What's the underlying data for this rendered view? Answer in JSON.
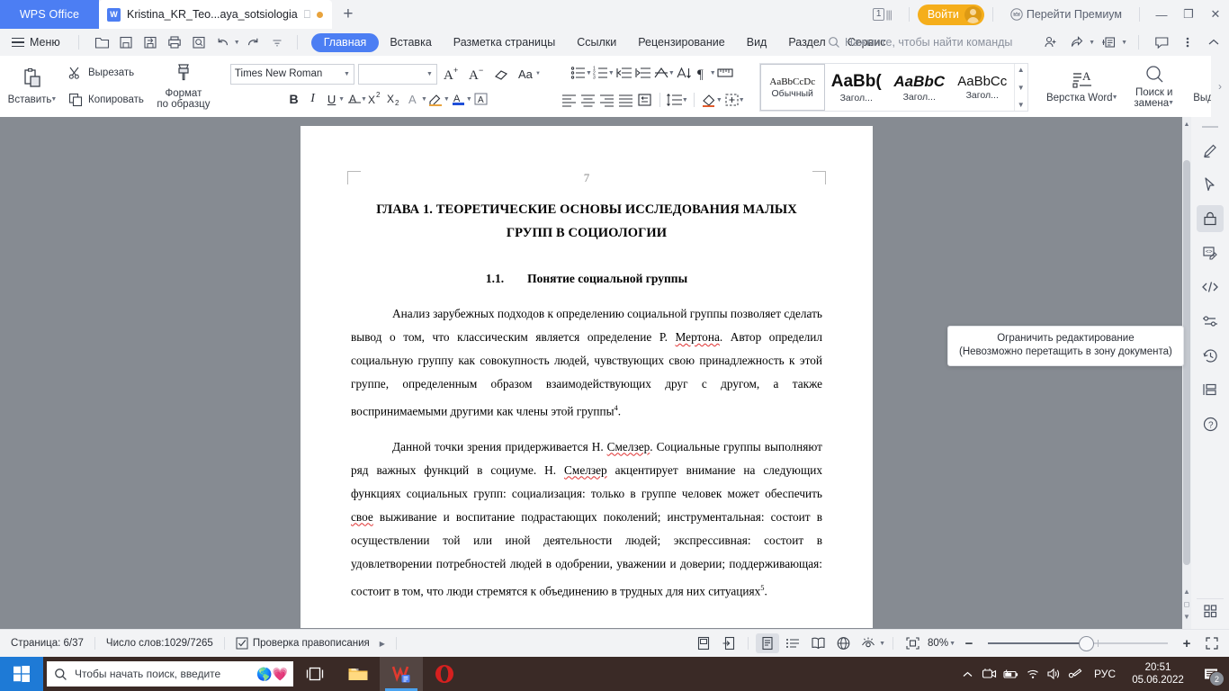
{
  "titlebar": {
    "app_name": "WPS Office",
    "tab_title": "Kristina_KR_Teo...aya_sotsiologia",
    "new_tab": "+",
    "count_badge": "1",
    "login_label": "Войти",
    "premium_label": "Перейти Премиум",
    "minimize": "—",
    "restore": "❐",
    "close": "✕"
  },
  "menurow": {
    "menu_label": "Меню",
    "quick_access": [
      "open-icon",
      "save-icon",
      "save-as-icon",
      "print-icon",
      "print-preview-icon",
      "undo-icon",
      "redo-icon",
      "customize-icon"
    ],
    "tabs": [
      {
        "label": "Главная",
        "active": true
      },
      {
        "label": "Вставка",
        "active": false
      },
      {
        "label": "Разметка страницы",
        "active": false
      },
      {
        "label": "Ссылки",
        "active": false
      },
      {
        "label": "Рецензирование",
        "active": false
      },
      {
        "label": "Вид",
        "active": false
      },
      {
        "label": "Раздел",
        "active": false
      },
      {
        "label": "Сервис",
        "active": false
      }
    ],
    "search_placeholder": "Нажмите, чтобы найти команды",
    "right_icons": [
      "add-user-icon",
      "share-icon",
      "collaborate-icon",
      "comment-icon",
      "more-icon",
      "collapse-ribbon-icon"
    ]
  },
  "ribbon": {
    "paste_label": "Вставить",
    "cut_label": "Вырезать",
    "copy_label": "Копировать",
    "format_painter_label": "Формат",
    "format_painter_label2": "по образцу",
    "font_name": "Times New Roman",
    "font_size": "",
    "font_buttons": [
      "grow-font-icon",
      "shrink-font-icon",
      "clear-format-icon",
      "change-case-icon"
    ],
    "format_buttons": [
      "bold-icon",
      "italic-icon",
      "underline-icon",
      "strikethrough-icon",
      "superscript-icon",
      "subscript-icon",
      "text-effects-icon",
      "highlight-icon",
      "font-color-icon",
      "character-border-icon"
    ],
    "paragraph_buttons_row1": [
      "bullets-icon",
      "numbering-icon",
      "decrease-indent-icon",
      "increase-indent-icon",
      "smart-layout-icon",
      "sort-icon",
      "show-marks-icon",
      "ruler-icon"
    ],
    "paragraph_buttons_row2": [
      "align-left-icon",
      "align-center-icon",
      "align-right-icon",
      "justify-icon",
      "distribute-icon",
      "line-spacing-icon",
      "shading-icon",
      "borders-icon"
    ],
    "styles": [
      {
        "preview": "AaBbCcDc",
        "name": "Обычный",
        "selected": true
      },
      {
        "preview": "AaBb(",
        "name": "Загол...",
        "selected": false
      },
      {
        "preview": "AaBbC",
        "name": "Загол...",
        "selected": false
      },
      {
        "preview": "AaBbCc",
        "name": "Загол...",
        "selected": false
      }
    ],
    "word_layout_label": "Верстка Word",
    "find_replace_label": "Поиск и",
    "find_replace_label2": "замена",
    "select_label": "Выделить"
  },
  "tooltip": {
    "line1": "Ограничить редактирование",
    "line2": "(Невозможно перетащить в зону документа)"
  },
  "rail": {
    "icons": [
      "pen-icon",
      "cursor-select-icon",
      "lock-icon",
      "edit-markup-icon",
      "code-icon",
      "settings-sliders-icon",
      "history-icon",
      "layout-panel-icon",
      "help-icon",
      "apps-grid-icon"
    ]
  },
  "document": {
    "page_number": "7",
    "heading_line1": "ГЛАВА 1. ТЕОРЕТИЧЕСКИЕ ОСНОВЫ ИССЛЕДОВАНИЯ МАЛЫХ",
    "heading_line2": "ГРУПП В СОЦИОЛОГИИ",
    "subheading_number": "1.1.",
    "subheading_text": "Понятие социальной группы",
    "paragraph1_part1": "Анализ зарубежных подходов к определению социальной группы позволяет сделать вывод о том, что классическим является определение Р. ",
    "paragraph1_misspelled1": "Мертона",
    "paragraph1_part2": ". Автор определил социальную группу как совокупность людей, чувствующих свою принадлежность к этой группе, определенным образом взаимодействующих друг с другом, а также воспринимаемыми другими как члены этой группы",
    "paragraph1_footnote": "4",
    "paragraph1_end": ".",
    "paragraph2_part1": "Данной точки зрения придерживается Н. ",
    "paragraph2_misspelled1": "Смелзер",
    "paragraph2_part2": ". Социальные группы выполняют ряд важных функций в социуме. Н. ",
    "paragraph2_misspelled2": "Смелзер",
    "paragraph2_part3": " акцентирует внимание на следующих функциях социальных групп: социализация: только в группе человек может обеспечить ",
    "paragraph2_misspelled3": "свое",
    "paragraph2_part4": " выживание и воспитание подрастающих поколений; инструментальная: состоит в осуществлении той или иной деятельности людей; экспрессивная: состоит в удовлетворении потребностей людей в одобрении, уважении и доверии; поддерживающая: состоит в том, что люди стремятся к объединению в трудных для них ситуациях",
    "paragraph2_footnote": "5",
    "paragraph2_end": "."
  },
  "status": {
    "page_label": "Страница: 6/37",
    "words_label": "Число слов:1029/7265",
    "spellcheck_label": "Проверка правописания",
    "view_icons": [
      "page-thumbnail-icon",
      "export-icon",
      "print-layout-icon",
      "outline-icon",
      "reading-layout-icon",
      "web-layout-icon",
      "eye-protect-icon"
    ],
    "fit_icon": "fit-page-icon",
    "zoom_level": "80%",
    "zoom_out": "−",
    "zoom_in": "+",
    "fullscreen_icon": "fullscreen-icon"
  },
  "taskbar": {
    "start_icon": "windows-start-icon",
    "search_placeholder": "Чтобы начать поиск, введите",
    "task_view_icon": "task-view-icon",
    "pinned": [
      "file-explorer-icon",
      "wps-writer-icon",
      "opera-icon"
    ],
    "tray_icons": [
      "show-hidden-icon",
      "camera-icon",
      "battery-icon",
      "wifi-icon",
      "volume-icon",
      "pen-tool-icon"
    ],
    "language": "РУС",
    "time": "20:51",
    "date": "05.06.2022",
    "notification_count": "2"
  }
}
